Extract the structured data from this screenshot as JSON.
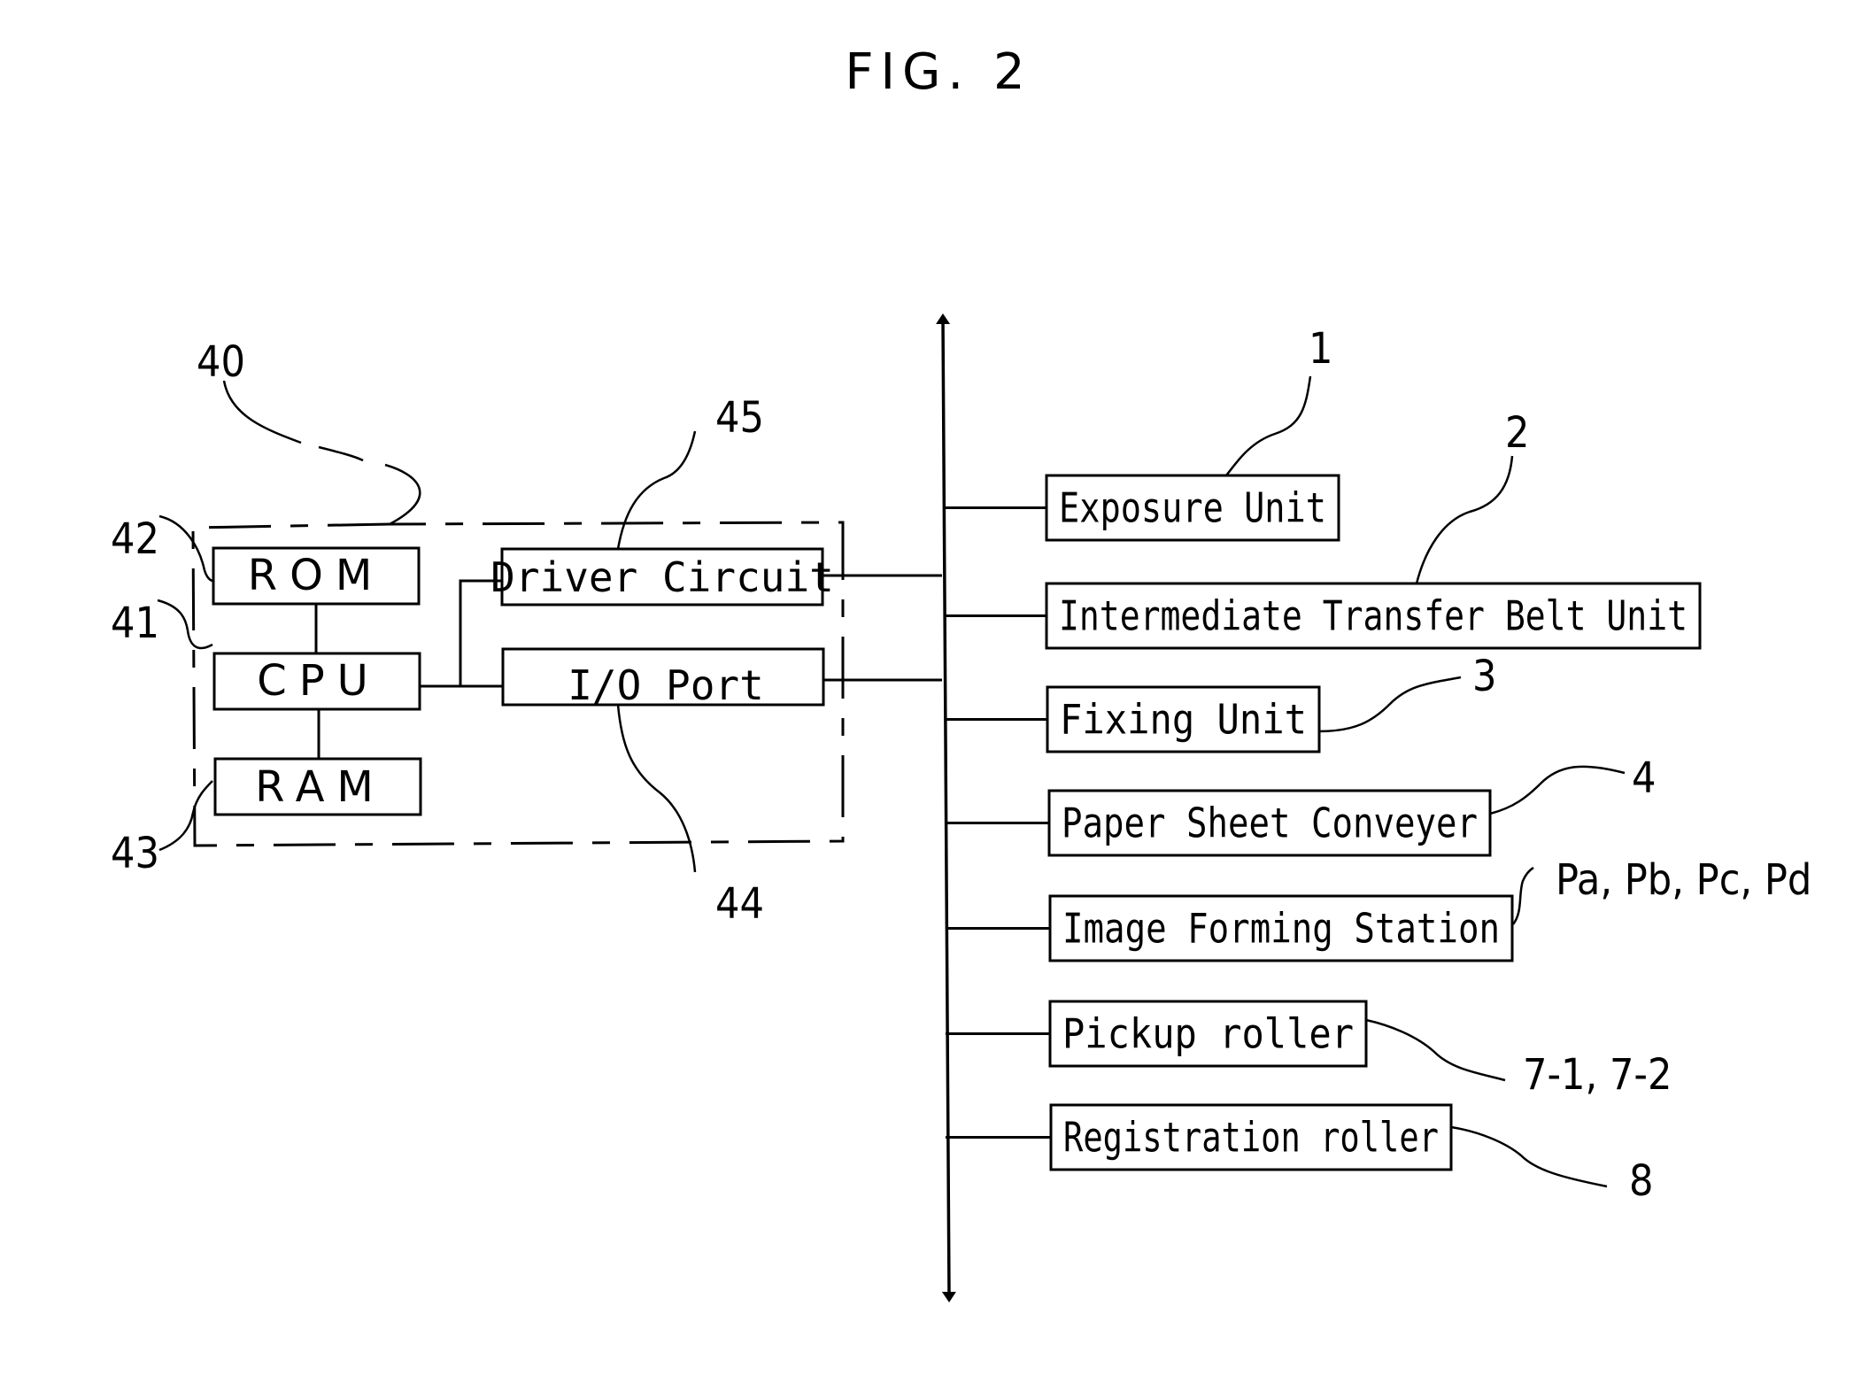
{
  "figure": {
    "title": "FIG. 2"
  },
  "controller": {
    "ref": "40",
    "rom": {
      "label": "ROM",
      "ref": "42"
    },
    "cpu": {
      "label": "CPU",
      "ref": "41"
    },
    "ram": {
      "label": "RAM",
      "ref": "43"
    },
    "driver_circuit": {
      "label": "Driver Circuit",
      "ref": "45"
    },
    "io_port": {
      "label": "I/O Port",
      "ref": "44"
    }
  },
  "units": [
    {
      "label": "Exposure Unit",
      "ref": "1"
    },
    {
      "label": "Intermediate Transfer Belt Unit",
      "ref": "2"
    },
    {
      "label": "Fixing Unit",
      "ref": "3"
    },
    {
      "label": "Paper Sheet Conveyer",
      "ref": "4"
    },
    {
      "label": "Image Forming Station",
      "ref": "Pa, Pb, Pc, Pd"
    },
    {
      "label": "Pickup roller",
      "ref": "7-1, 7-2"
    },
    {
      "label": "Registration roller",
      "ref": "8"
    }
  ]
}
